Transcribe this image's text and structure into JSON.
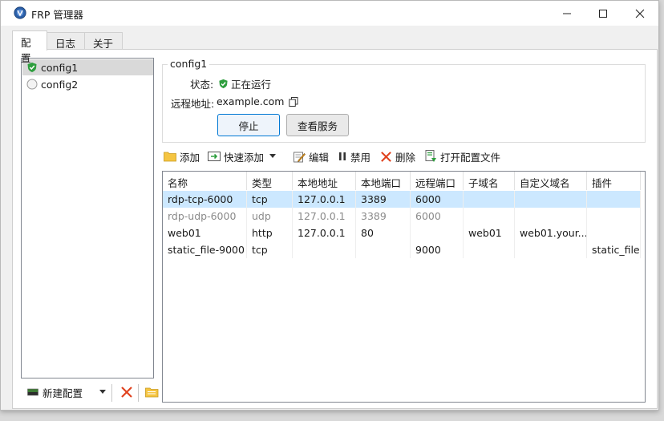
{
  "window": {
    "title": "FRP 管理器"
  },
  "tabs": [
    {
      "label": "配置"
    },
    {
      "label": "日志"
    },
    {
      "label": "关于"
    }
  ],
  "configs": [
    {
      "name": "config1",
      "status": "running"
    },
    {
      "name": "config2",
      "status": "stopped"
    }
  ],
  "left_bar": {
    "new_config_label": "新建配置"
  },
  "detail": {
    "group_title": "config1",
    "status_label": "状态:",
    "status_value": "正在运行",
    "remote_label": "远程地址:",
    "remote_value": "example.com",
    "stop_button": "停止",
    "view_service_button": "查看服务"
  },
  "toolbar": {
    "add": "添加",
    "quick_add": "快速添加",
    "edit": "编辑",
    "disable": "禁用",
    "delete": "删除",
    "open_config_file": "打开配置文件"
  },
  "table": {
    "columns": [
      "名称",
      "类型",
      "本地地址",
      "本地端口",
      "远程端口",
      "子域名",
      "自定义域名",
      "插件"
    ],
    "rows": [
      [
        "rdp-tcp-6000",
        "tcp",
        "127.0.0.1",
        "3389",
        "6000",
        "",
        "",
        ""
      ],
      [
        "rdp-udp-6000",
        "udp",
        "127.0.0.1",
        "3389",
        "6000",
        "",
        "",
        ""
      ],
      [
        "web01",
        "http",
        "127.0.0.1",
        "80",
        "",
        "web01",
        "web01.your...",
        ""
      ],
      [
        "static_file-9000",
        "tcp",
        "",
        "",
        "9000",
        "",
        "",
        "static_file"
      ]
    ],
    "selected_row": 0,
    "disabled_rows": [
      1
    ]
  },
  "colors": {
    "accent": "#0078d4",
    "selection": "#cce8ff",
    "running": "#2e9e3e"
  }
}
